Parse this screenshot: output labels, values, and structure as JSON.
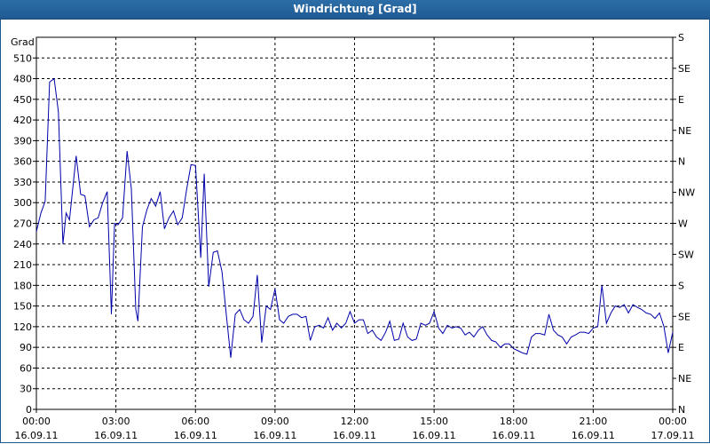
{
  "window": {
    "title": "Windrichtung [Grad]"
  },
  "chart_data": {
    "type": "line",
    "title": "Windrichtung [Grad]",
    "ylabel": "Grad",
    "ylim": [
      0,
      540
    ],
    "y_ticks": [
      0,
      30,
      60,
      90,
      120,
      150,
      180,
      210,
      240,
      270,
      300,
      330,
      360,
      390,
      420,
      450,
      480,
      510
    ],
    "y2_ticks": [
      {
        "value": 0,
        "label": "N"
      },
      {
        "value": 45,
        "label": "NE"
      },
      {
        "value": 90,
        "label": "E"
      },
      {
        "value": 135,
        "label": "SE"
      },
      {
        "value": 180,
        "label": "S"
      },
      {
        "value": 225,
        "label": "SW"
      },
      {
        "value": 270,
        "label": "W"
      },
      {
        "value": 315,
        "label": "NW"
      },
      {
        "value": 360,
        "label": "N"
      },
      {
        "value": 405,
        "label": "NE"
      },
      {
        "value": 450,
        "label": "E"
      },
      {
        "value": 495,
        "label": "SE"
      },
      {
        "value": 540,
        "label": "S"
      }
    ],
    "xlim_hours": [
      0,
      24
    ],
    "x_ticks": [
      {
        "hour": 0,
        "time": "00:00",
        "date": "16.09.11"
      },
      {
        "hour": 3,
        "time": "03:00",
        "date": "16.09.11"
      },
      {
        "hour": 6,
        "time": "06:00",
        "date": "16.09.11"
      },
      {
        "hour": 9,
        "time": "09:00",
        "date": "16.09.11"
      },
      {
        "hour": 12,
        "time": "12:00",
        "date": "16.09.11"
      },
      {
        "hour": 15,
        "time": "15:00",
        "date": "16.09.11"
      },
      {
        "hour": 18,
        "time": "18:00",
        "date": "16.09.11"
      },
      {
        "hour": 21,
        "time": "21:00",
        "date": "16.09.11"
      },
      {
        "hour": 24,
        "time": "00:00",
        "date": "17.09.11"
      }
    ],
    "grid": true,
    "line_color": "#0000aa",
    "series": [
      {
        "name": "",
        "points": [
          [
            0.0,
            258
          ],
          [
            0.17,
            285
          ],
          [
            0.33,
            302
          ],
          [
            0.5,
            475
          ],
          [
            0.67,
            480
          ],
          [
            0.83,
            432
          ],
          [
            1.0,
            240
          ],
          [
            1.12,
            285
          ],
          [
            1.25,
            275
          ],
          [
            1.5,
            368
          ],
          [
            1.67,
            312
          ],
          [
            1.83,
            310
          ],
          [
            2.0,
            265
          ],
          [
            2.17,
            275
          ],
          [
            2.33,
            278
          ],
          [
            2.5,
            300
          ],
          [
            2.67,
            316
          ],
          [
            2.83,
            138
          ],
          [
            2.95,
            270
          ],
          [
            3.08,
            268
          ],
          [
            3.25,
            278
          ],
          [
            3.42,
            375
          ],
          [
            3.58,
            320
          ],
          [
            3.75,
            145
          ],
          [
            3.83,
            128
          ],
          [
            4.0,
            265
          ],
          [
            4.17,
            290
          ],
          [
            4.33,
            306
          ],
          [
            4.5,
            295
          ],
          [
            4.67,
            316
          ],
          [
            4.83,
            262
          ],
          [
            5.0,
            278
          ],
          [
            5.17,
            288
          ],
          [
            5.33,
            268
          ],
          [
            5.5,
            278
          ],
          [
            5.67,
            320
          ],
          [
            5.83,
            355
          ],
          [
            6.0,
            354
          ],
          [
            6.2,
            220
          ],
          [
            6.33,
            342
          ],
          [
            6.5,
            178
          ],
          [
            6.67,
            228
          ],
          [
            6.83,
            230
          ],
          [
            7.0,
            200
          ],
          [
            7.17,
            135
          ],
          [
            7.33,
            75
          ],
          [
            7.5,
            138
          ],
          [
            7.67,
            145
          ],
          [
            7.83,
            130
          ],
          [
            8.0,
            125
          ],
          [
            8.17,
            135
          ],
          [
            8.33,
            195
          ],
          [
            8.5,
            97
          ],
          [
            8.67,
            150
          ],
          [
            8.83,
            145
          ],
          [
            9.0,
            175
          ],
          [
            9.17,
            130
          ],
          [
            9.33,
            125
          ],
          [
            9.5,
            135
          ],
          [
            9.67,
            138
          ],
          [
            9.83,
            138
          ],
          [
            10.0,
            133
          ],
          [
            10.17,
            135
          ],
          [
            10.33,
            100
          ],
          [
            10.5,
            120
          ],
          [
            10.67,
            122
          ],
          [
            10.83,
            118
          ],
          [
            11.0,
            133
          ],
          [
            11.17,
            115
          ],
          [
            11.33,
            125
          ],
          [
            11.5,
            118
          ],
          [
            11.67,
            125
          ],
          [
            11.83,
            142
          ],
          [
            12.0,
            125
          ],
          [
            12.17,
            130
          ],
          [
            12.33,
            130
          ],
          [
            12.5,
            110
          ],
          [
            12.67,
            115
          ],
          [
            12.83,
            105
          ],
          [
            13.0,
            100
          ],
          [
            13.17,
            112
          ],
          [
            13.33,
            128
          ],
          [
            13.5,
            100
          ],
          [
            13.67,
            102
          ],
          [
            13.83,
            125
          ],
          [
            14.0,
            105
          ],
          [
            14.17,
            100
          ],
          [
            14.33,
            102
          ],
          [
            14.5,
            125
          ],
          [
            14.67,
            122
          ],
          [
            14.83,
            125
          ],
          [
            15.0,
            142
          ],
          [
            15.17,
            118
          ],
          [
            15.33,
            110
          ],
          [
            15.5,
            122
          ],
          [
            15.67,
            118
          ],
          [
            15.83,
            120
          ],
          [
            16.0,
            118
          ],
          [
            16.17,
            108
          ],
          [
            16.33,
            112
          ],
          [
            16.5,
            105
          ],
          [
            16.67,
            115
          ],
          [
            16.83,
            120
          ],
          [
            17.0,
            108
          ],
          [
            17.17,
            100
          ],
          [
            17.33,
            98
          ],
          [
            17.5,
            90
          ],
          [
            17.67,
            95
          ],
          [
            17.83,
            95
          ],
          [
            18.0,
            88
          ],
          [
            18.17,
            85
          ],
          [
            18.33,
            82
          ],
          [
            18.5,
            80
          ],
          [
            18.67,
            105
          ],
          [
            18.83,
            110
          ],
          [
            19.0,
            110
          ],
          [
            19.17,
            108
          ],
          [
            19.33,
            138
          ],
          [
            19.5,
            115
          ],
          [
            19.67,
            108
          ],
          [
            19.83,
            105
          ],
          [
            20.0,
            95
          ],
          [
            20.17,
            105
          ],
          [
            20.33,
            108
          ],
          [
            20.5,
            112
          ],
          [
            20.67,
            112
          ],
          [
            20.83,
            110
          ],
          [
            21.0,
            118
          ],
          [
            21.17,
            120
          ],
          [
            21.33,
            180
          ],
          [
            21.5,
            125
          ],
          [
            21.67,
            140
          ],
          [
            21.83,
            150
          ],
          [
            22.0,
            148
          ],
          [
            22.17,
            152
          ],
          [
            22.33,
            140
          ],
          [
            22.5,
            152
          ],
          [
            22.67,
            148
          ],
          [
            22.83,
            145
          ],
          [
            23.0,
            140
          ],
          [
            23.17,
            138
          ],
          [
            23.33,
            132
          ],
          [
            23.5,
            140
          ],
          [
            23.67,
            120
          ],
          [
            23.83,
            82
          ],
          [
            24.0,
            112
          ]
        ]
      }
    ]
  }
}
